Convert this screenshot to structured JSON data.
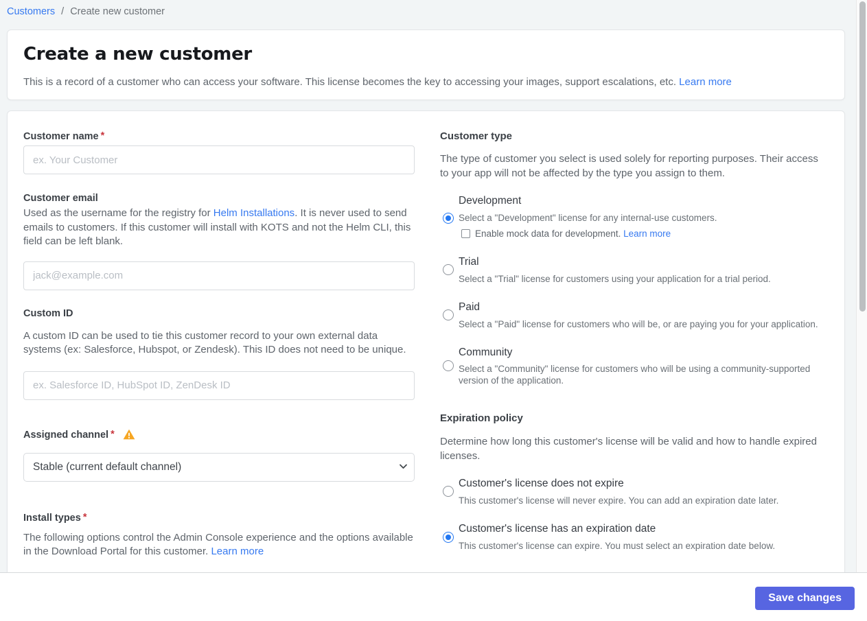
{
  "breadcrumb": {
    "root": "Customers",
    "separator": "/",
    "current": "Create new customer"
  },
  "header": {
    "title": "Create a new customer",
    "description": "This is a record of a customer who can access your software. This license becomes the key to accessing your images, support escalations, etc.",
    "learn_more": "Learn more"
  },
  "form": {
    "customer_name": {
      "label": "Customer name",
      "required_mark": "*",
      "value": "",
      "placeholder": "ex. Your Customer"
    },
    "customer_email": {
      "label": "Customer email",
      "description_before_link": "Used as the username for the registry for ",
      "link": "Helm Installations",
      "description_after_link": ". It is never used to send emails to customers. If this customer will install with KOTS and not the Helm CLI, this field can be left blank.",
      "value": "",
      "placeholder": "jack@example.com"
    },
    "custom_id": {
      "label": "Custom ID",
      "description": "A custom ID can be used to tie this customer record to your own external data systems (ex: Salesforce, Hubspot, or Zendesk). This ID does not need to be unique.",
      "value": "",
      "placeholder": "ex. Salesforce ID, HubSpot ID, ZenDesk ID"
    },
    "assigned_channel": {
      "label": "Assigned channel",
      "required_mark": "*",
      "has_warning": true,
      "selected_option": "Stable (current default channel)"
    },
    "install_types": {
      "label": "Install types",
      "required_mark": "*",
      "description": "The following options control the Admin Console experience and the options available in the Download Portal for this customer.",
      "learn_more": "Learn more"
    }
  },
  "customer_type": {
    "label": "Customer type",
    "description": "The type of customer you select is used solely for reporting purposes. Their access to your app will not be affected by the type you assign to them.",
    "options": [
      {
        "title": "Development",
        "description": "Select a \"Development\" license for any internal-use customers.",
        "selected": true,
        "checkbox_label": "Enable mock data for development.",
        "checkbox_learn_more": "Learn more",
        "checkbox_checked": false
      },
      {
        "title": "Trial",
        "description": "Select a \"Trial\" license for customers using your application for a trial period.",
        "selected": false
      },
      {
        "title": "Paid",
        "description": "Select a \"Paid\" license for customers who will be, or are paying you for your application.",
        "selected": false
      },
      {
        "title": "Community",
        "description": "Select a \"Community\" license for customers who will be using a community-supported version of the application.",
        "selected": false
      }
    ]
  },
  "expiration_policy": {
    "label": "Expiration policy",
    "description": "Determine how long this customer's license will be valid and how to handle expired licenses.",
    "options": [
      {
        "title": "Customer's license does not expire",
        "description": "This customer's license will never expire. You can add an expiration date later.",
        "selected": false
      },
      {
        "title": "Customer's license has an expiration date",
        "description": "This customer's license can expire. You must select an expiration date below.",
        "selected": true
      }
    ]
  },
  "footer": {
    "save_label": "Save changes"
  },
  "colors": {
    "link_blue": "#3679f0",
    "save_button": "#5765e1",
    "radio_selected": "#2277f2",
    "warning_orange": "#f6a623",
    "required_red": "#c8353d",
    "page_background": "#f2f5f6"
  }
}
